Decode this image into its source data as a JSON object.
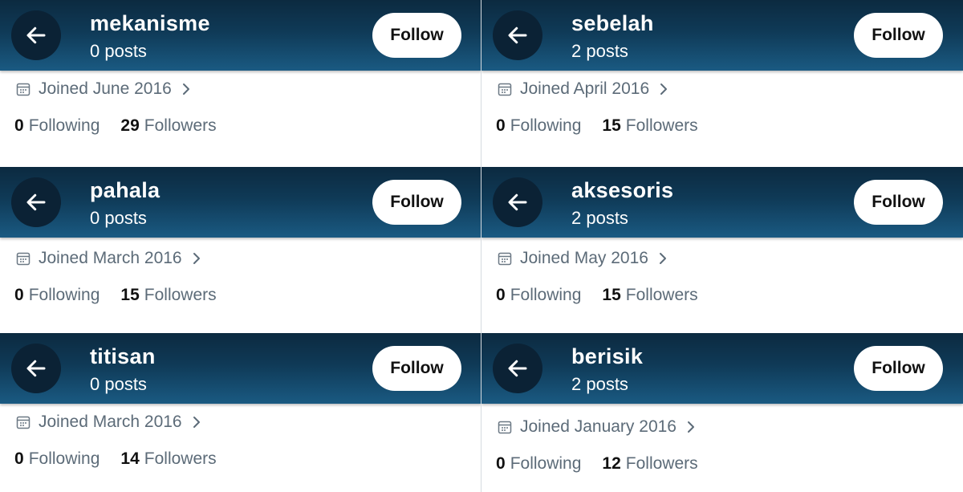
{
  "follow_label": "Follow",
  "following_label": "Following",
  "followers_label": "Followers",
  "profiles": [
    {
      "username": "mekanisme",
      "posts": "0 posts",
      "joined": "Joined June 2016",
      "following": "0",
      "followers": "29"
    },
    {
      "username": "sebelah",
      "posts": "2 posts",
      "joined": "Joined April 2016",
      "following": "0",
      "followers": "15"
    },
    {
      "username": "pahala",
      "posts": "0 posts",
      "joined": "Joined March 2016",
      "following": "0",
      "followers": "15"
    },
    {
      "username": "aksesoris",
      "posts": "2 posts",
      "joined": "Joined May 2016",
      "following": "0",
      "followers": "15"
    },
    {
      "username": "titisan",
      "posts": "0 posts",
      "joined": "Joined March 2016",
      "following": "0",
      "followers": "14"
    },
    {
      "username": "berisik",
      "posts": "2 posts",
      "joined": "Joined January 2016",
      "following": "0",
      "followers": "12"
    }
  ],
  "colors": {
    "header_dark": "#0c2a40",
    "header_light": "#1a5a82",
    "back_circle": "#0b2235",
    "meta_text": "#5c6b78"
  }
}
